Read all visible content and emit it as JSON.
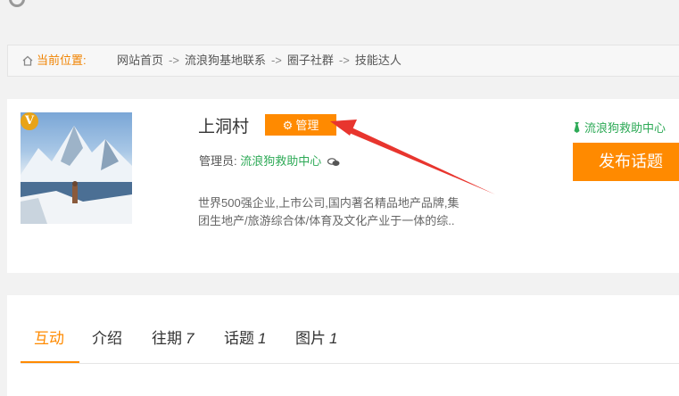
{
  "breadcrumb": {
    "label": "当前位置:",
    "items": [
      "网站首页",
      "流浪狗基地联系",
      "圈子社群",
      "技能达人"
    ],
    "separator": "->"
  },
  "group": {
    "name": "上洞村",
    "manage_label": "管理",
    "admin_label": "管理员:",
    "admin_name": "流浪狗救助中心",
    "description": "世界500强企业,上市公司,国内著名精品地产品牌,集团生地产/旅游综合体/体育及文化产业于一体的综..",
    "badge": "V"
  },
  "sidebar": {
    "rescue_link": "流浪狗救助中心",
    "publish_label": "发布话题"
  },
  "tabs": [
    {
      "label": "互动",
      "count": ""
    },
    {
      "label": "介绍",
      "count": ""
    },
    {
      "label": "往期",
      "count": "7"
    },
    {
      "label": "话题",
      "count": "1"
    },
    {
      "label": "图片",
      "count": "1"
    }
  ],
  "colors": {
    "accent": "#ff8a00",
    "link_green": "#2eaa57",
    "arrow_red": "#e8352e"
  }
}
